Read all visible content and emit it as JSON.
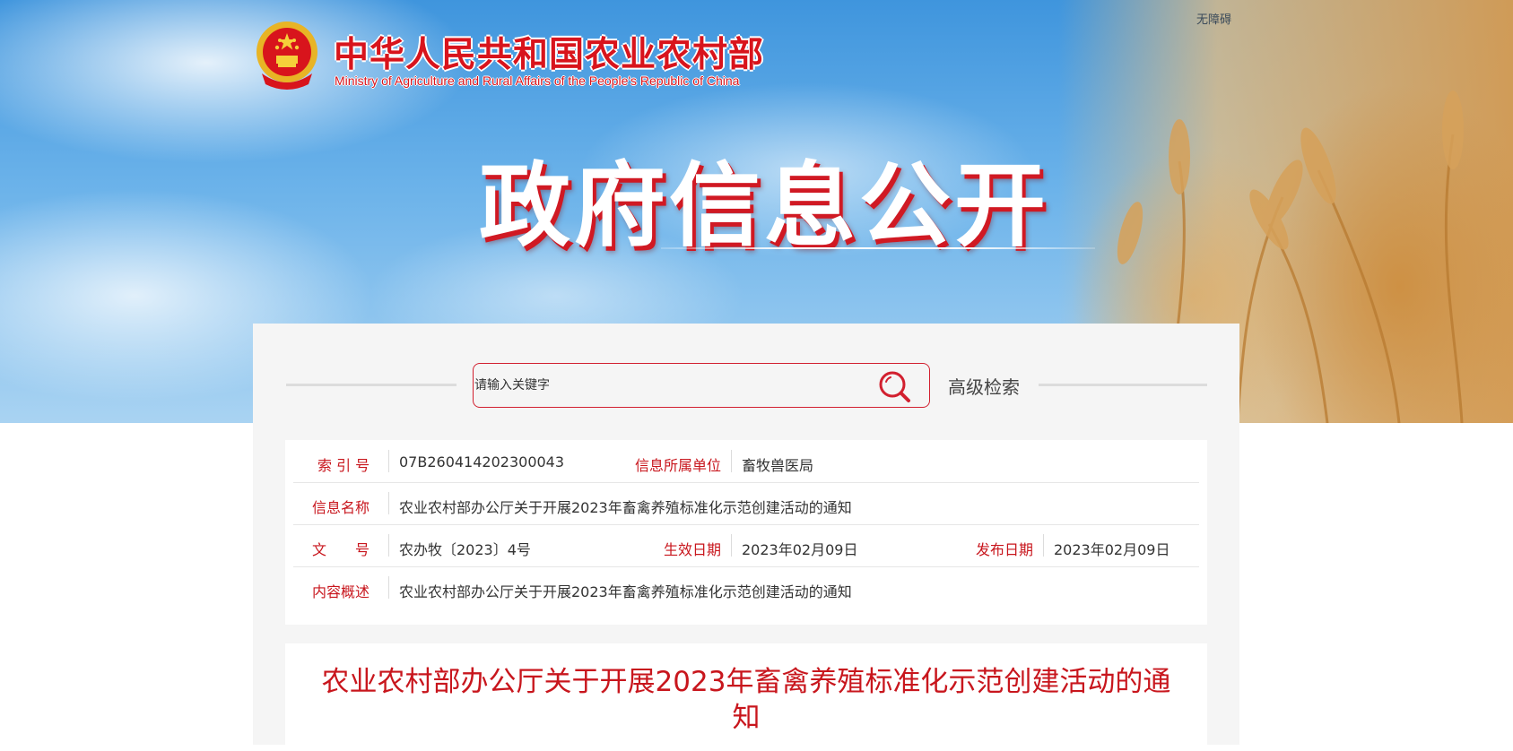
{
  "header": {
    "accessibility_link": "无障碍",
    "ministry_name_cn": "中华人民共和国农业农村部",
    "ministry_name_en": "Ministry of Agriculture and Rural Affairs of the People's Republic of China",
    "hero_title": "政府信息公开"
  },
  "search": {
    "placeholder": "请输入关键字",
    "search_icon": "magnifier-icon",
    "advanced_label": "高级检索"
  },
  "info": {
    "index_no": {
      "label": "索 引 号",
      "value": "07B260414202300043"
    },
    "unit": {
      "label": "信息所属单位",
      "value": "畜牧兽医局"
    },
    "name": {
      "label": "信息名称",
      "value": "农业农村部办公厅关于开展2023年畜禽养殖标准化示范创建活动的通知"
    },
    "doc_no": {
      "label": "文　　号",
      "value": "农办牧〔2023〕4号"
    },
    "effective_date": {
      "label": "生效日期",
      "value": "2023年02月09日"
    },
    "publish_date": {
      "label": "发布日期",
      "value": "2023年02月09日"
    },
    "summary": {
      "label": "内容概述",
      "value": "农业农村部办公厅关于开展2023年畜禽养殖标准化示范创建活动的通知"
    }
  },
  "article": {
    "title": "农业农村部办公厅关于开展2023年畜禽养殖标准化示范创建活动的通知"
  },
  "colors": {
    "brand_red": "#c8161d",
    "sky_blue": "#3f95dd",
    "panel_bg": "#f5f5f5"
  }
}
